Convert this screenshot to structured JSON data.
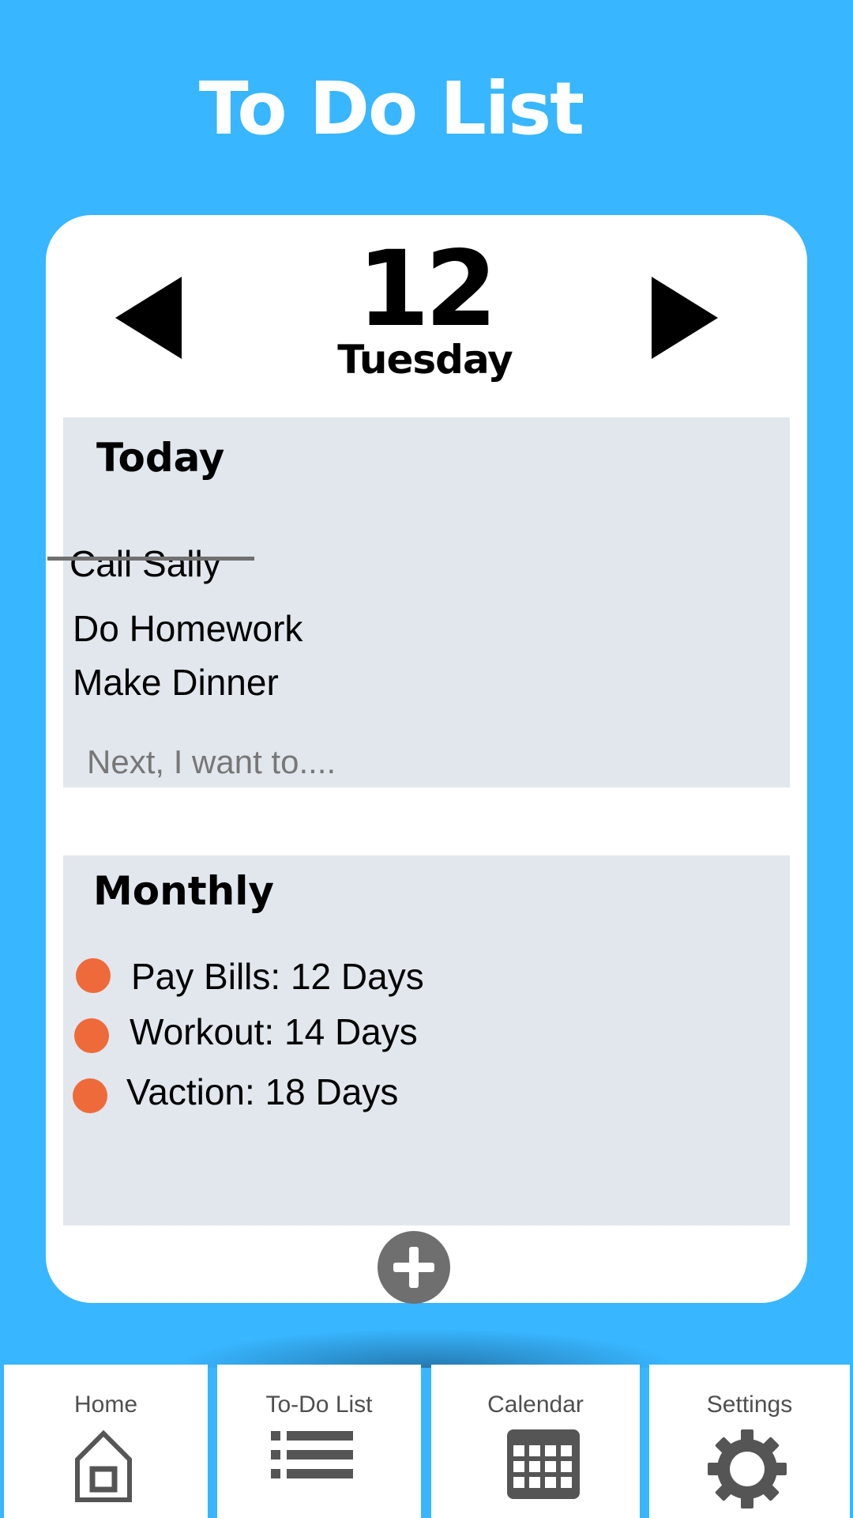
{
  "header": {
    "title": "To Do List"
  },
  "date": {
    "day_number": "12",
    "weekday": "Tuesday"
  },
  "today": {
    "title": "Today",
    "tasks": [
      {
        "label": "Call Sally",
        "completed": true
      },
      {
        "label": "Do Homework",
        "completed": false
      },
      {
        "label": "Make Dinner",
        "completed": false
      }
    ],
    "input_placeholder": "Next, I want to...."
  },
  "monthly": {
    "title": "Monthly",
    "items": [
      {
        "label": "Pay Bills: 12 Days"
      },
      {
        "label": "Workout: 14 Days"
      },
      {
        "label": "Vaction: 18 Days"
      }
    ]
  },
  "nav": {
    "items": [
      {
        "label": "Home",
        "icon": "home-icon"
      },
      {
        "label": "To-Do List",
        "icon": "list-icon"
      },
      {
        "label": "Calendar",
        "icon": "calendar-icon"
      },
      {
        "label": "Settings",
        "icon": "gear-icon"
      }
    ]
  },
  "colors": {
    "background": "#38b6ff",
    "card": "#ffffff",
    "panel": "#e1e7ed",
    "bullet": "#ee6a3a",
    "icon": "#555555",
    "add_button": "#6f6f70"
  }
}
